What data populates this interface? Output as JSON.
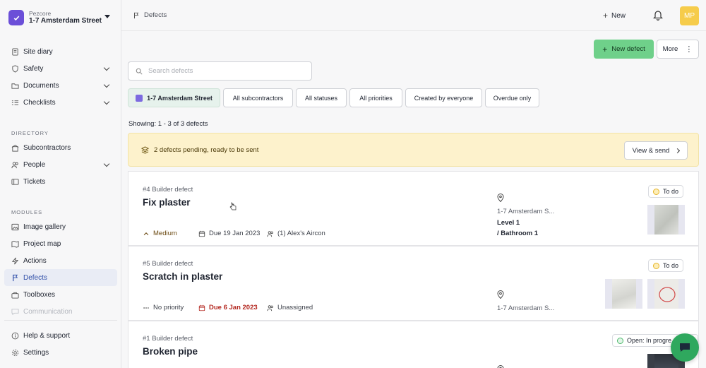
{
  "org": {
    "name": "Pezcore",
    "site": "1-7 Amsterdam Street"
  },
  "sidebar": {
    "items": [
      {
        "label": "Site diary",
        "icon": "book-icon"
      },
      {
        "label": "Safety",
        "icon": "shield-icon"
      },
      {
        "label": "Documents",
        "icon": "folder-icon"
      },
      {
        "label": "Checklists",
        "icon": "checklist-icon"
      }
    ],
    "directory_title": "DIRECTORY",
    "directory": [
      {
        "label": "Subcontractors",
        "icon": "building-icon"
      },
      {
        "label": "People",
        "icon": "people-icon"
      },
      {
        "label": "Tickets",
        "icon": "ticket-icon"
      }
    ],
    "modules_title": "MODULES",
    "modules": [
      {
        "label": "Image gallery",
        "icon": "image-icon"
      },
      {
        "label": "Project map",
        "icon": "map-icon"
      },
      {
        "label": "Actions",
        "icon": "bolt-icon"
      },
      {
        "label": "Defects",
        "icon": "flag-icon"
      },
      {
        "label": "Toolboxes",
        "icon": "toolbox-icon"
      },
      {
        "label": "Communication",
        "icon": "chat-icon"
      }
    ],
    "footer": [
      {
        "label": "Help & support",
        "icon": "info-icon"
      },
      {
        "label": "Settings",
        "icon": "gear-icon"
      }
    ]
  },
  "header": {
    "breadcrumb": "Defects",
    "new_label": "New",
    "avatar_initials": "MP"
  },
  "toolbar": {
    "new_defect": "New defect",
    "more": "More"
  },
  "search": {
    "placeholder": "Search defects",
    "value": ""
  },
  "filters": [
    "1-7 Amsterdam Street",
    "All subcontractors",
    "All statuses",
    "All priorities",
    "Created by everyone",
    "Overdue only"
  ],
  "showing": "Showing: 1 - 3 of 3 defects",
  "banner": {
    "text": "2 defects pending, ready to be sent",
    "button": "View & send"
  },
  "defects": [
    {
      "ref": "#4 Builder defect",
      "title": "Fix plaster",
      "priority": "Medium",
      "due": "Due 19 Jan 2023",
      "assignee": "(1)  Alex's Aircon",
      "location_site": "1-7 Amsterdam S...",
      "location_level": "Level 1",
      "location_room": "/ Bathroom 1",
      "status": "To do"
    },
    {
      "ref": "#5 Builder defect",
      "title": "Scratch in plaster",
      "priority": "No priority",
      "due": "Due 6 Jan 2023",
      "assignee": "Unassigned",
      "location_site": "1-7 Amsterdam S...",
      "status": "To do"
    },
    {
      "ref": "#1 Builder defect",
      "title": "Broken pipe",
      "status": "Open: In progre"
    }
  ],
  "colors": {
    "accent": "#6fd08a",
    "active_nav": "#2f4ea8",
    "banner": "#fdf2cc",
    "overdue": "#b3261e",
    "avatar": "#f6cc4b"
  }
}
